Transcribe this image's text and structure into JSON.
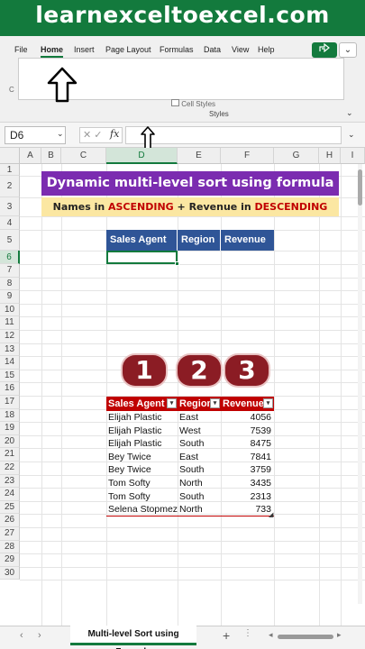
{
  "banner": {
    "text": "learnexceltoexcel.com"
  },
  "ribbon": {
    "tabs": [
      "File",
      "Home",
      "Insert",
      "Page Layout",
      "Formulas",
      "Data",
      "View",
      "Help"
    ],
    "active_tab": "Home",
    "styles_group_label": "Styles",
    "cell_styles_label": "Cell Styles"
  },
  "formula_bar": {
    "name_box": "D6",
    "fx_label": "fx",
    "formula": ""
  },
  "columns": [
    "A",
    "B",
    "C",
    "D",
    "E",
    "F",
    "G",
    "H",
    "I"
  ],
  "rows": [
    "1",
    "2",
    "3",
    "4",
    "5",
    "6",
    "7",
    "8",
    "9",
    "10",
    "11",
    "12",
    "13",
    "14",
    "15",
    "16",
    "17",
    "18",
    "19",
    "20",
    "21",
    "22",
    "23",
    "24",
    "25",
    "26",
    "27",
    "28",
    "29",
    "30"
  ],
  "title": "Dynamic multi-level sort using formula",
  "subtitle": {
    "p1": "Names in ",
    "p2": "ASCENDING",
    "p3": " + Revenue in ",
    "p4": "DESCENDING"
  },
  "output_headers": [
    "Sales Agent",
    "Region",
    "Revenue"
  ],
  "badges": [
    "1",
    "2",
    "3"
  ],
  "table": {
    "headers": [
      "Sales Agent",
      "Region",
      "Revenue"
    ],
    "rows": [
      [
        "Elijah Plastic",
        "East",
        "4056"
      ],
      [
        "Elijah Plastic",
        "West",
        "7539"
      ],
      [
        "Elijah Plastic",
        "South",
        "8475"
      ],
      [
        "Bey Twice",
        "East",
        "7841"
      ],
      [
        "Bey Twice",
        "South",
        "3759"
      ],
      [
        "Tom Softy",
        "North",
        "3435"
      ],
      [
        "Tom Softy",
        "South",
        "2313"
      ],
      [
        "Selena Stopmez",
        "North",
        "733"
      ]
    ]
  },
  "sheet_tab": "Multi-level Sort using Formula",
  "colors": {
    "brand_green": "#137a3d",
    "title_purple": "#7b2cb0",
    "subtitle_yellow": "#fbe7a2",
    "header_blue": "#2f5597",
    "table_red": "#c00000",
    "badge_red": "#8b1c24"
  }
}
